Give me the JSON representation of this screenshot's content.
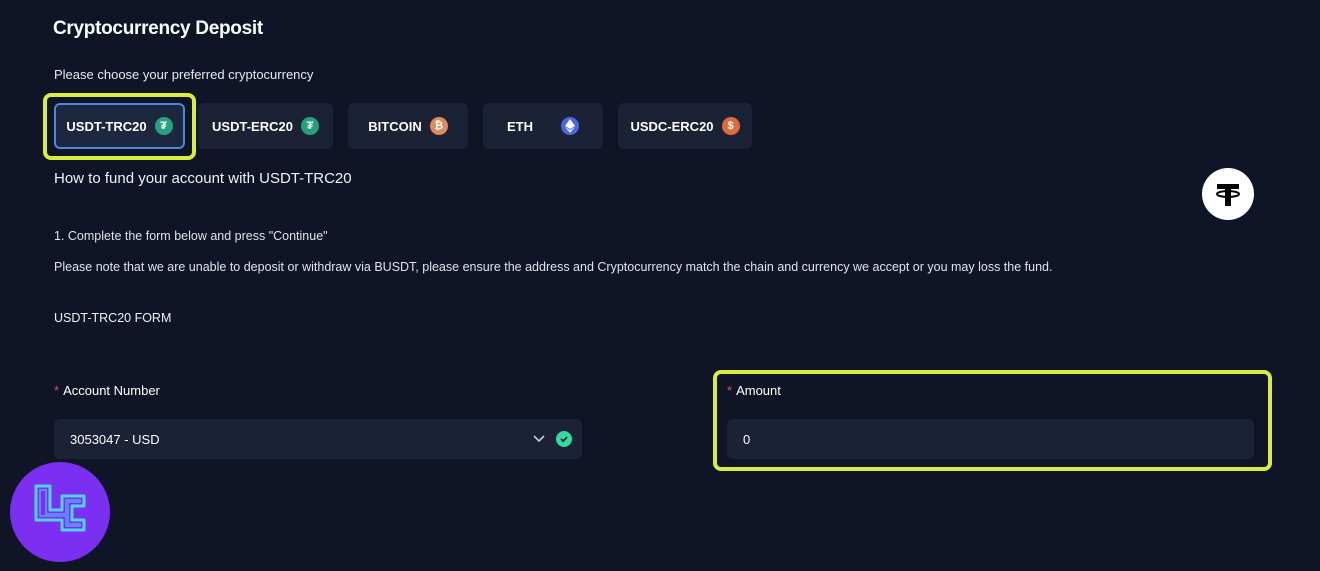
{
  "page": {
    "title": "Cryptocurrency Deposit",
    "choose_label": "Please choose your preferred cryptocurrency"
  },
  "coins": [
    {
      "label": "USDT-TRC20",
      "icon": "tether-icon",
      "active": true
    },
    {
      "label": "USDT-ERC20",
      "icon": "tether-icon",
      "active": false
    },
    {
      "label": "BITCOIN",
      "icon": "bitcoin-icon",
      "active": false
    },
    {
      "label": "ETH",
      "icon": "ethereum-icon",
      "active": false
    },
    {
      "label": "USDC-ERC20",
      "icon": "usdc-icon",
      "active": false
    }
  ],
  "instructions": {
    "heading": "How to fund your account with USDT-TRC20",
    "step1": "1. Complete the form below and press \"Continue\"",
    "note": "Please note that we are unable to deposit or withdraw via BUSDT, please ensure the address and Cryptocurrency match the chain and currency we accept or you may loss the fund."
  },
  "form": {
    "title": "USDT-TRC20 FORM",
    "account_label": "Account Number",
    "account_value": "3053047 - USD",
    "amount_label": "Amount",
    "amount_value": "0",
    "required_mark": "*"
  },
  "colors": {
    "background": "#0f1526",
    "highlight": "#d8ee3e",
    "active_border": "#4f87d8",
    "brand": "#7b2ff0"
  }
}
